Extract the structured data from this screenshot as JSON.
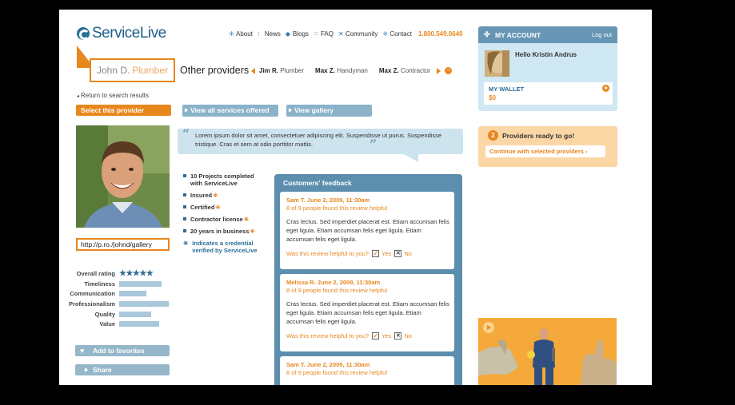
{
  "brand": {
    "name": "ServiceLive"
  },
  "nav": {
    "items": [
      {
        "label": "About",
        "icon": "grid-icon"
      },
      {
        "label": "News",
        "icon": "dots-icon"
      },
      {
        "label": "Blogs",
        "icon": "diamond-icon"
      },
      {
        "label": "FAQ",
        "icon": "question-icon"
      },
      {
        "label": "Community",
        "icon": "people-icon"
      },
      {
        "label": "Contact",
        "icon": "grid-icon"
      }
    ],
    "phone": "1.800.549.0640"
  },
  "provider": {
    "name": "John D.",
    "trade": "Plumber",
    "gallery_url": "http://p.ro./johnd/gallery"
  },
  "other_providers": {
    "title": "Other providers",
    "items": [
      {
        "name": "Jim R.",
        "trade": "Plumber"
      },
      {
        "name": "Max Z.",
        "trade": "Handyman"
      },
      {
        "name": "Max Z.",
        "trade": "Contractor"
      }
    ]
  },
  "actions": {
    "return_label": "Return to search results",
    "select_label": "Select this provider",
    "view_services_label": "View all services offered",
    "view_gallery_label": "View gallery",
    "favorites_label": "Add to favorites",
    "share_label": "Share"
  },
  "quote": {
    "text": "Lorem ipsum dolor sit amet, consectetuer adipiscing elit. Suspendisse ut purus. Suspendisse tristique. Cras et sem at odio porttitor mattis."
  },
  "facts": [
    {
      "text": "10 Projects completed with ServiceLive",
      "credential": false
    },
    {
      "text": "Insured",
      "credential": true
    },
    {
      "text": "Certified",
      "credential": true
    },
    {
      "text": "Contractor license",
      "credential": true
    },
    {
      "text": "20  years in business",
      "credential": true
    }
  ],
  "credential_note": "Indicates a credential verified by ServiceLive",
  "ratings": {
    "overall_label": "Overall rating",
    "overall_stars": 5,
    "categories": [
      {
        "label": "Timeliness",
        "value": 0.85
      },
      {
        "label": "Communication",
        "value": 0.55
      },
      {
        "label": "Professionalism",
        "value": 1.0
      },
      {
        "label": "Quality",
        "value": 0.65
      },
      {
        "label": "Value",
        "value": 0.8
      }
    ]
  },
  "feedback": {
    "title": "Customers' feedback",
    "helpful_question": "Was this review helpful to you?",
    "yes_label": "Yes",
    "no_label": "No",
    "reviews": [
      {
        "author": "Sam T.",
        "date": "June 2, 2009, 11:30am",
        "helpful": "8 of 9 people found this review helpful",
        "body": "Cras lectus. Sed imperdiet placerat est. Etiam accumsan felis eget ligula. Etiam accumsan felis eget ligula. Etiam accumsan felis eget ligula."
      },
      {
        "author": "Melissa R.",
        "date": "June 2, 2009, 11:30am",
        "helpful": "8 of 9 people found this review helpful",
        "body": "Cras lectus. Sed imperdiet placerat est. Etiam accumsan felis eget ligula. Etiam accumsan felis eget ligula. Etiam accumsan felis eget ligula."
      },
      {
        "author": "Sam T.",
        "date": "June 2, 2009, 11:30am",
        "helpful": "8 of 9 people found this review helpful",
        "body": ""
      }
    ]
  },
  "account": {
    "title": "MY ACCOUNT",
    "logout_label": "Log out",
    "greeting": "Hello Kristin Andrus",
    "wallet_label": "MY WALLET",
    "wallet_value": "$0"
  },
  "ready": {
    "count": "2",
    "text": "Providers ready to go!",
    "button_label": "Continue with selected providers"
  },
  "colors": {
    "accent": "#e8871e",
    "primary": "#2a6e99",
    "panel": "#5c8eae"
  }
}
